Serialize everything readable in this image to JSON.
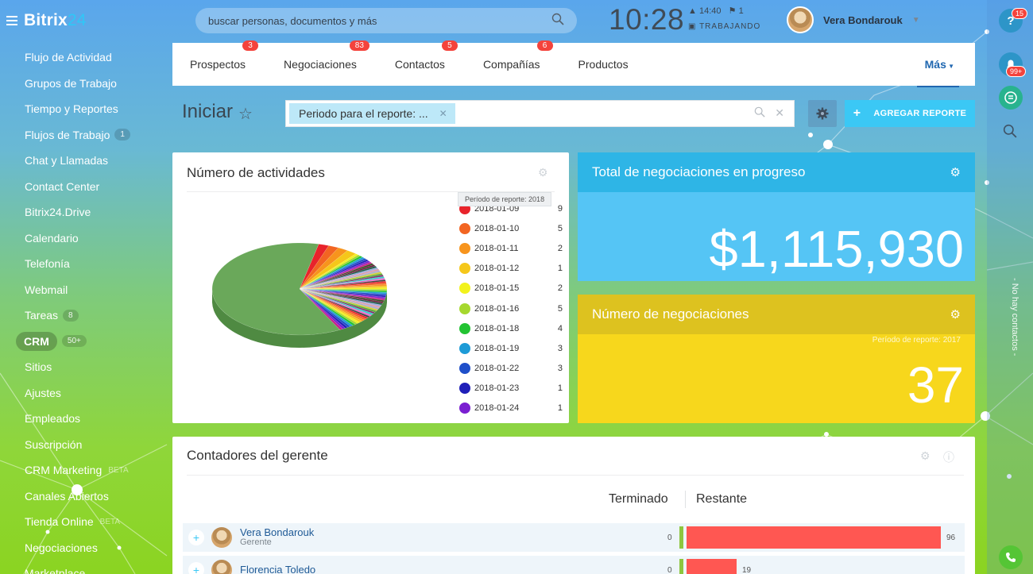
{
  "brand": {
    "name": "Bitrix",
    "num": "24"
  },
  "search": {
    "placeholder": "buscar personas, documentos y más"
  },
  "clock": {
    "time": "10:28",
    "alarm": "14:40",
    "flags": "1",
    "status": "TRABAJANDO"
  },
  "user": {
    "name": "Vera Bondarouk"
  },
  "rail": {
    "help_count": "15",
    "notif_count": "99+",
    "no_contacts": "- No hay contactos -"
  },
  "sidebar": {
    "items": [
      {
        "label": "Flujo de Actividad"
      },
      {
        "label": "Grupos de Trabajo"
      },
      {
        "label": "Tiempo y Reportes"
      },
      {
        "label": "Flujos de Trabajo",
        "count": "1"
      },
      {
        "label": "Chat y Llamadas"
      },
      {
        "label": "Contact Center"
      },
      {
        "label": "Bitrix24.Drive"
      },
      {
        "label": "Calendario"
      },
      {
        "label": "Telefonía"
      },
      {
        "label": "Webmail"
      },
      {
        "label": "Tareas",
        "count": "8"
      },
      {
        "label": "CRM",
        "count": "50+"
      },
      {
        "label": "Sitios"
      },
      {
        "label": "Ajustes"
      },
      {
        "label": "Empleados"
      },
      {
        "label": "Suscripción"
      },
      {
        "label": "CRM Marketing",
        "tag": "BETA"
      },
      {
        "label": "Canales Abiertos"
      },
      {
        "label": "Tienda Online",
        "tag": "BETA"
      },
      {
        "label": "Negociaciones"
      },
      {
        "label": "Marketplace"
      }
    ]
  },
  "tabs": [
    {
      "label": "Prospectos",
      "badge": "3"
    },
    {
      "label": "Negociaciones",
      "badge": "83"
    },
    {
      "label": "Contactos",
      "badge": "5"
    },
    {
      "label": "Compañías",
      "badge": "6"
    },
    {
      "label": "Productos",
      "badge": ""
    }
  ],
  "more": "Más",
  "toolbar": {
    "title": "Iniciar",
    "filter_chip": "Periodo para el reporte: ...",
    "add_report": "AGREGAR REPORTE"
  },
  "activities": {
    "title": "Número de actividades",
    "tooltip": "Período de reporte: 2018"
  },
  "chart_data": {
    "type": "pie",
    "title": "Número de actividades",
    "legend": [
      {
        "label": "2018-01-09",
        "value": 9,
        "color": "#e8232b"
      },
      {
        "label": "2018-01-10",
        "value": 5,
        "color": "#f26522"
      },
      {
        "label": "2018-01-11",
        "value": 2,
        "color": "#f7941d"
      },
      {
        "label": "2018-01-12",
        "value": 1,
        "color": "#f5c71a"
      },
      {
        "label": "2018-01-15",
        "value": 2,
        "color": "#f2f21c"
      },
      {
        "label": "2018-01-16",
        "value": 5,
        "color": "#a6d82e"
      },
      {
        "label": "2018-01-18",
        "value": 4,
        "color": "#22c332"
      },
      {
        "label": "2018-01-19",
        "value": 3,
        "color": "#1e9bd7"
      },
      {
        "label": "2018-01-22",
        "value": 3,
        "color": "#1f4fc9"
      },
      {
        "label": "2018-01-23",
        "value": 1,
        "color": "#1f1fb8"
      },
      {
        "label": "2018-01-24",
        "value": 1,
        "color": "#7a1fd1"
      }
    ]
  },
  "deals_progress": {
    "title": "Total de negociaciones en progreso",
    "value": "$1,115,930"
  },
  "deals_count": {
    "title": "Número de negociaciones",
    "period": "Período de reporte: 2017",
    "value": "37"
  },
  "managers": {
    "title": "Contadores del gerente",
    "col_done": "Terminado",
    "col_left": "Restante",
    "rows": [
      {
        "name": "Vera Bondarouk",
        "role": "Gerente",
        "done": "0",
        "left": "96",
        "left_num": 96
      },
      {
        "name": "Florencia Toledo",
        "role": "",
        "done": "0",
        "left": "19",
        "left_num": 19
      }
    ]
  }
}
